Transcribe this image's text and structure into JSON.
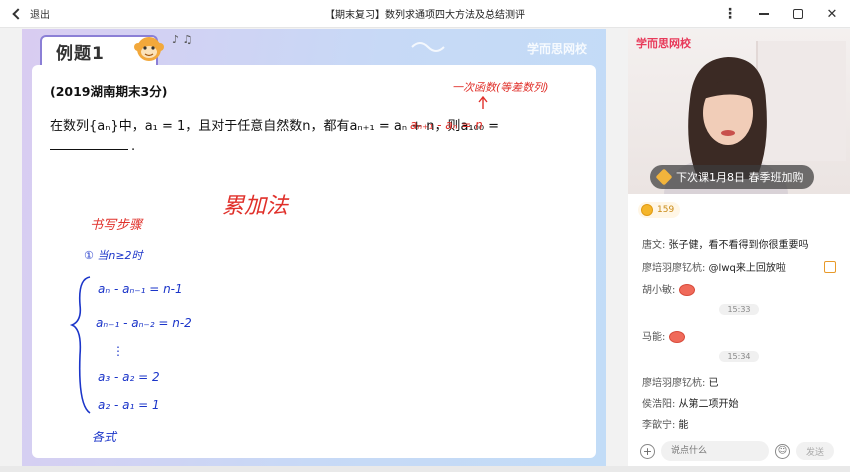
{
  "window": {
    "back_label": "退出",
    "title": "【期末复习】数列求通项四大方法及总结测评"
  },
  "slide": {
    "tag": "例题1",
    "notes": "♪ ♫",
    "watermark": "学而思网校",
    "source": "(2019湖南期末3分)",
    "question": "在数列{aₙ}中，a₁ = 1，且对于任意自然数n，都有aₙ₊₁ = aₙ + n，则a₁₀₀ =",
    "answer_dot": ".",
    "ink": {
      "top_note": "一次函数(等差数列)",
      "top_formula": "aₙ₊₁ - aₙ = n",
      "method": "累加法",
      "steps_title": "书写步骤",
      "step1": "① 当n≥2时",
      "line1": "aₙ - aₙ₋₁ = n-1",
      "line2": "aₙ₋₁ - aₙ₋₂ = n-2",
      "dots": "⋮",
      "line3": "a₃ - a₂ = 2",
      "line4": "a₂ - a₁ = 1",
      "sum": "各式"
    }
  },
  "panel": {
    "brand": "学而思网校",
    "next_class": "下次课1月8日  春季班加购",
    "coins": "159",
    "messages": [
      {
        "user": "唐文:",
        "text": " 张子健，看不看得到你很重要吗"
      },
      {
        "user": "廖培羽廖钇杭:",
        "text": " @lwq来上回放啦"
      },
      {
        "user": "胡小敏:",
        "text": ""
      },
      {
        "user": "马能:",
        "text": ""
      },
      {
        "user": "廖培羽廖钇杭:",
        "text": " 已"
      },
      {
        "user": "侯浩阳:",
        "text": " 从第二项开始"
      },
      {
        "user": "李歆宁:",
        "text": " 能"
      }
    ],
    "times": [
      "15:33",
      "15:34"
    ],
    "input_placeholder": "说点什么",
    "send_label": "发送"
  }
}
